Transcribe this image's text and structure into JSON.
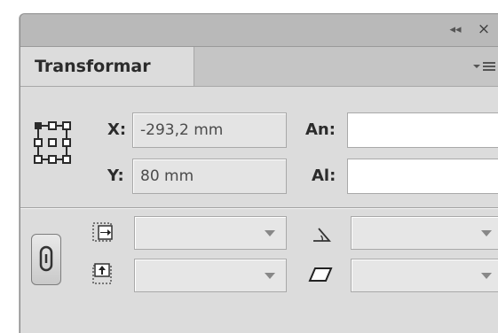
{
  "titlebar": {
    "collapse_icon": "double-left-chevron-icon",
    "collapse_glyph": "◂◂",
    "close_icon": "close-icon",
    "close_glyph": "×"
  },
  "panel": {
    "tab_label": "Transformar",
    "menu_icon": "panel-menu-icon"
  },
  "position": {
    "x_label": "X:",
    "x_value": "-293,2 mm",
    "y_label": "Y:",
    "y_value": "80 mm"
  },
  "size": {
    "width_label": "An:",
    "width_value": "",
    "height_label": "Al:",
    "height_value": ""
  },
  "scale": {
    "scale_x_icon": "horizontal-scale-icon",
    "scale_x_value": "",
    "scale_y_icon": "vertical-scale-icon",
    "scale_y_value": "",
    "constrain_icon": "link-proportions-icon"
  },
  "rotate": {
    "rotate_icon": "rotate-angle-icon",
    "rotate_value": "",
    "shear_icon": "shear-icon",
    "shear_value": ""
  },
  "reference_point": {
    "icon": "reference-point-grid-icon",
    "selected": "top-left"
  },
  "colors": {
    "panel_bg": "#dcdcdc",
    "titlebar_bg": "#b9b9b9",
    "field_bg": "#e4e4e4"
  }
}
